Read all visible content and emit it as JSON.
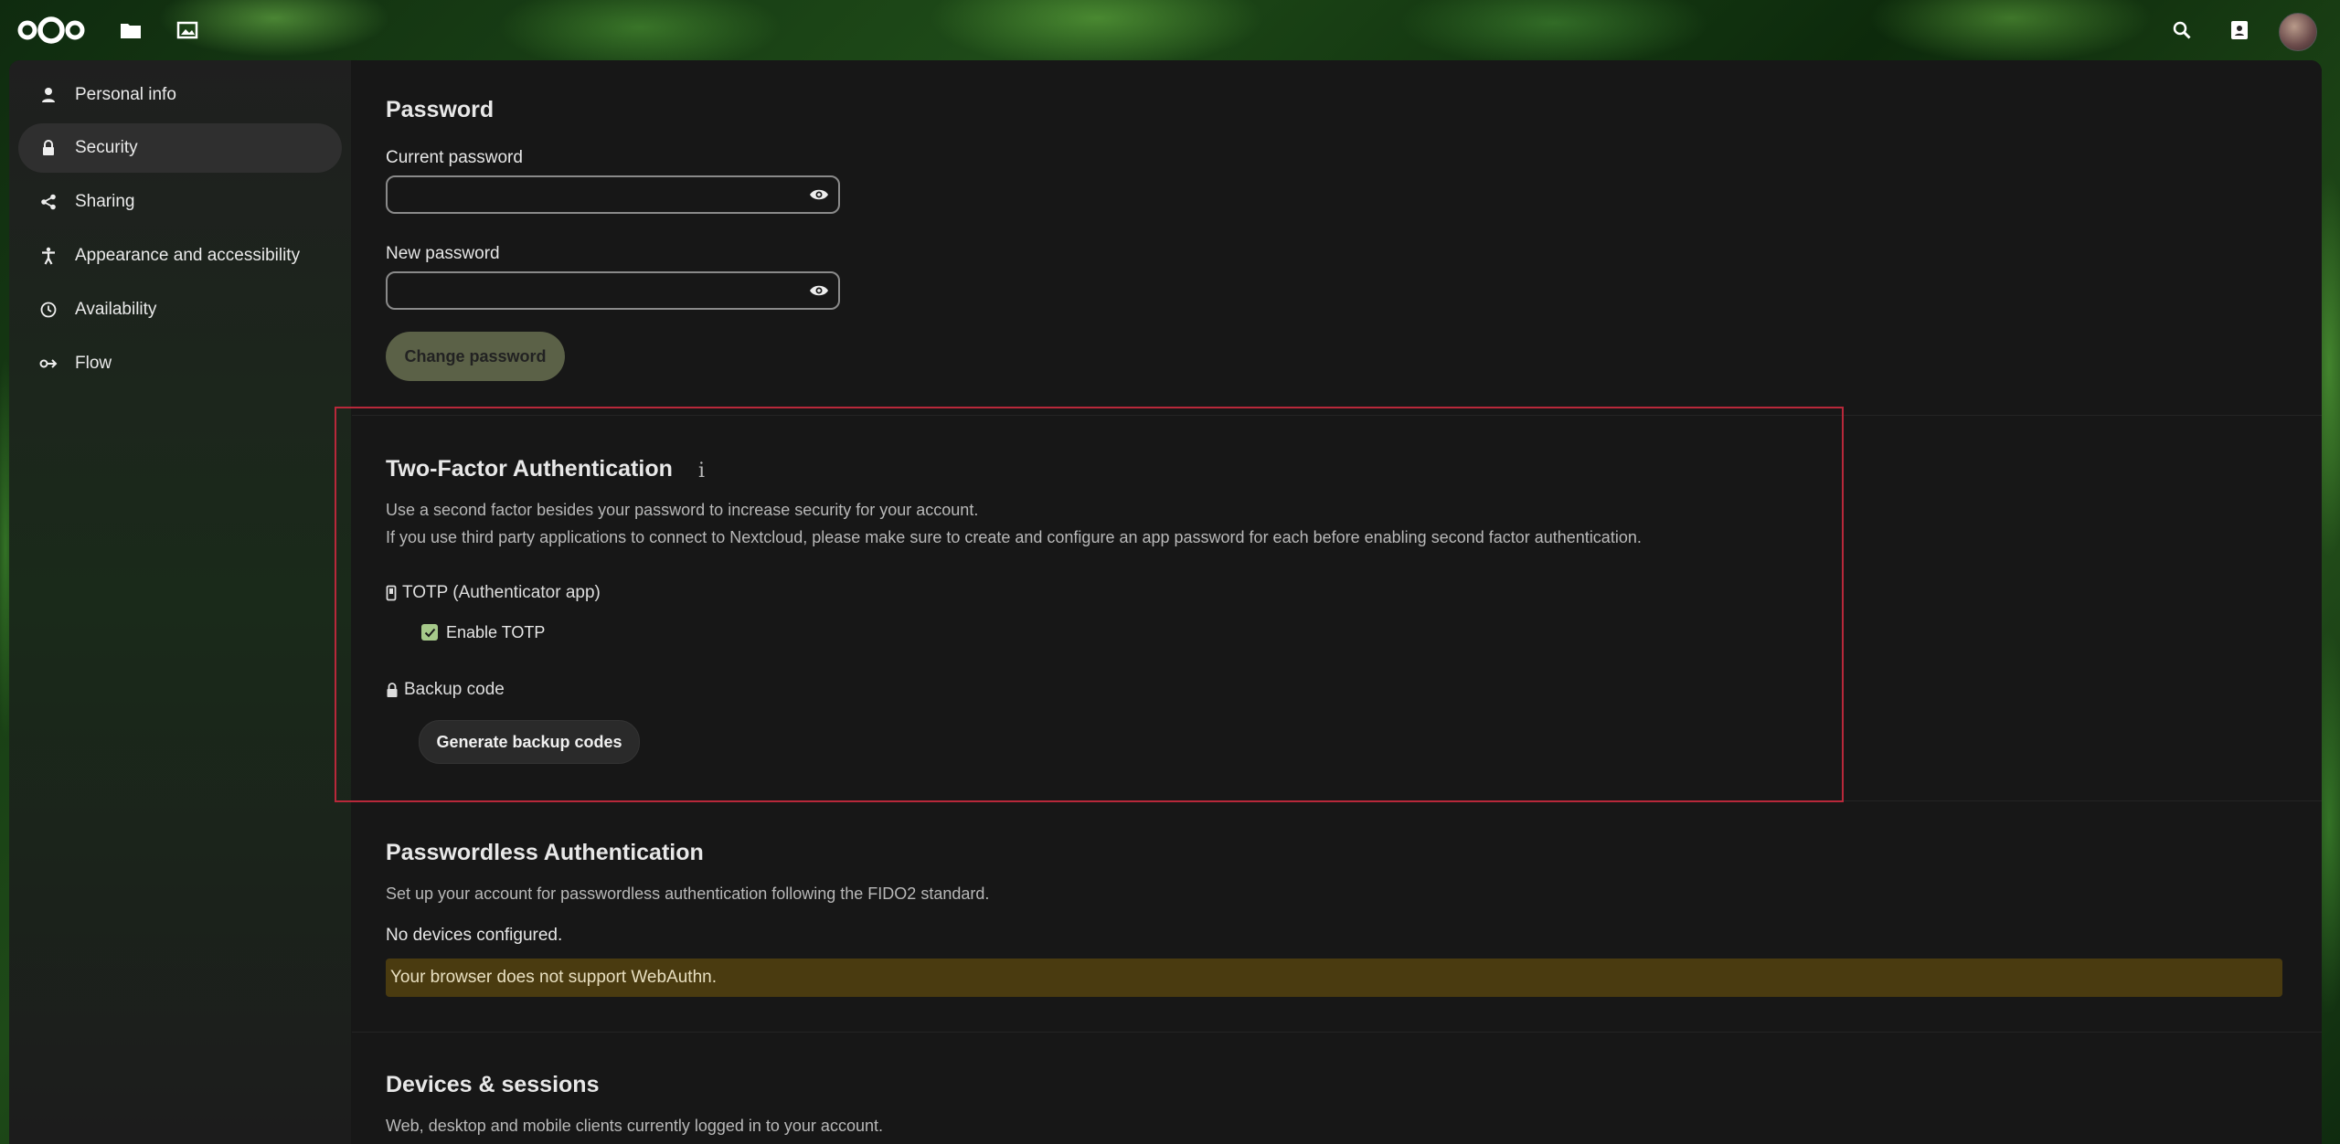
{
  "header": {
    "logo": "nextcloud-logo",
    "apps": [
      {
        "name": "Files",
        "icon": "folder-icon"
      },
      {
        "name": "Photos",
        "icon": "image-icon"
      }
    ],
    "right": [
      {
        "name": "Search",
        "icon": "search-icon"
      },
      {
        "name": "Contacts",
        "icon": "contacts-icon"
      }
    ]
  },
  "sidebar": {
    "items": [
      {
        "label": "Personal info",
        "icon": "person-icon",
        "active": false
      },
      {
        "label": "Security",
        "icon": "lock-icon",
        "active": true
      },
      {
        "label": "Sharing",
        "icon": "share-icon",
        "active": false
      },
      {
        "label": "Appearance and accessibility",
        "icon": "accessibility-icon",
        "active": false
      },
      {
        "label": "Availability",
        "icon": "clock-icon",
        "active": false
      },
      {
        "label": "Flow",
        "icon": "flow-icon",
        "active": false
      }
    ]
  },
  "password": {
    "title": "Password",
    "current_label": "Current password",
    "current_value": "",
    "new_label": "New password",
    "new_value": "",
    "change_button": "Change password"
  },
  "two_factor": {
    "title": "Two-Factor Authentication",
    "info_icon": "i",
    "desc1": "Use a second factor besides your password to increase security for your account.",
    "desc2": "If you use third party applications to connect to Nextcloud, please make sure to create and configure an app password for each before enabling second factor authentication.",
    "totp_label": "TOTP (Authenticator app)",
    "enable_totp_label": "Enable TOTP",
    "enable_totp_checked": true,
    "backup_label": "Backup code",
    "generate_button": "Generate backup codes"
  },
  "passwordless": {
    "title": "Passwordless Authentication",
    "desc": "Set up your account for passwordless authentication following the FIDO2 standard.",
    "no_devices": "No devices configured.",
    "warning": "Your browser does not support WebAuthn."
  },
  "devices": {
    "title": "Devices & sessions",
    "desc": "Web, desktop and mobile clients currently logged in to your account."
  },
  "colors": {
    "accent": "#5b6147",
    "warning_bg": "#4a3b10",
    "highlight_border": "#b8283a"
  }
}
